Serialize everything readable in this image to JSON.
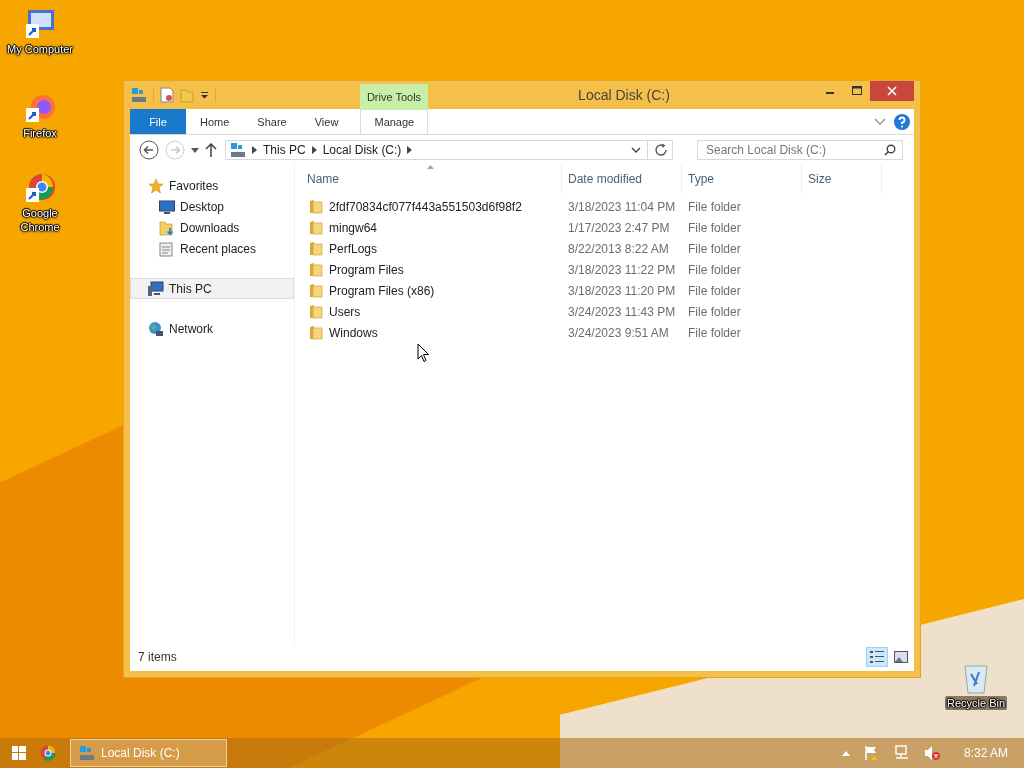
{
  "desktop_icons": [
    {
      "label": "My Computer",
      "kind": "computer"
    },
    {
      "label": "Firefox",
      "kind": "firefox"
    },
    {
      "label": "Google Chrome",
      "kind": "chrome"
    },
    {
      "label": "Recycle Bin",
      "kind": "recycle"
    }
  ],
  "window": {
    "title": "Local Disk (C:)",
    "context_tab": "Drive Tools"
  },
  "ribbon_tabs": [
    {
      "label": "File",
      "kind": "file",
      "selected": false
    },
    {
      "label": "Home",
      "kind": "tab",
      "selected": false
    },
    {
      "label": "Share",
      "kind": "tab",
      "selected": false
    },
    {
      "label": "View",
      "kind": "tab",
      "selected": false
    },
    {
      "label": "Manage",
      "kind": "context",
      "selected": false
    }
  ],
  "address": {
    "crumbs": [
      "This PC",
      "Local Disk (C:)"
    ]
  },
  "search": {
    "placeholder": "Search Local Disk (C:)"
  },
  "nav": [
    {
      "label": "Favorites",
      "kind": "star",
      "selected": false,
      "children": [
        {
          "label": "Desktop",
          "kind": "desktop",
          "selected": false
        },
        {
          "label": "Downloads",
          "kind": "downloads",
          "selected": false
        },
        {
          "label": "Recent places",
          "kind": "recent",
          "selected": false
        }
      ]
    },
    {
      "label": "This PC",
      "kind": "pc",
      "selected": true
    },
    {
      "label": "Network",
      "kind": "network",
      "selected": false
    }
  ],
  "table": {
    "columns": [
      "Name",
      "Date modified",
      "Type",
      "Size"
    ],
    "rows": [
      {
        "name": "2fdf70834cf077f443a551503d6f98f2",
        "date": "3/18/2023 11:04 PM",
        "type": "File folder"
      },
      {
        "name": "mingw64",
        "date": "1/17/2023 2:47 PM",
        "type": "File folder"
      },
      {
        "name": "PerfLogs",
        "date": "8/22/2013 8:22 AM",
        "type": "File folder"
      },
      {
        "name": "Program Files",
        "date": "3/18/2023 11:22 PM",
        "type": "File folder"
      },
      {
        "name": "Program Files (x86)",
        "date": "3/18/2023 11:20 PM",
        "type": "File folder"
      },
      {
        "name": "Users",
        "date": "3/24/2023 11:43 PM",
        "type": "File folder"
      },
      {
        "name": "Windows",
        "date": "3/24/2023 9:51 AM",
        "type": "File folder"
      }
    ]
  },
  "status_bar": {
    "count": "7 items",
    "views": [
      {
        "kind": "details",
        "selected": true
      },
      {
        "kind": "tiles",
        "selected": false
      }
    ]
  },
  "taskbar": {
    "task": "Local Disk (C:)",
    "clock": "8:32 AM"
  }
}
